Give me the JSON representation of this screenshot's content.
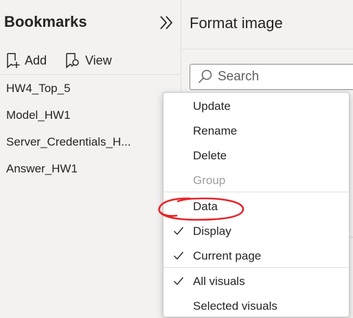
{
  "bookmarks": {
    "title": "Bookmarks",
    "toolbar": {
      "add_label": "Add",
      "view_label": "View"
    },
    "items": [
      {
        "label": "HW4_Top_5"
      },
      {
        "label": "Model_HW1"
      },
      {
        "label": "Server_Credentials_H..."
      },
      {
        "label": "Answer_HW1"
      }
    ]
  },
  "format_pane": {
    "title": "Format image",
    "search": {
      "placeholder": "Search"
    }
  },
  "context_menu": {
    "items": [
      {
        "label": "Update",
        "checked": false,
        "disabled": false
      },
      {
        "label": "Rename",
        "checked": false,
        "disabled": false
      },
      {
        "label": "Delete",
        "checked": false,
        "disabled": false
      },
      {
        "label": "Group",
        "checked": false,
        "disabled": true
      },
      {
        "label": "Data",
        "checked": false,
        "disabled": false,
        "annotated": true
      },
      {
        "label": "Display",
        "checked": true,
        "disabled": false
      },
      {
        "label": "Current page",
        "checked": true,
        "disabled": false
      },
      {
        "label": "All visuals",
        "checked": true,
        "disabled": false
      },
      {
        "label": "Selected visuals",
        "checked": false,
        "disabled": false
      }
    ]
  },
  "colors": {
    "pane_background": "#f3f2f1",
    "menu_background": "#ffffff",
    "text": "#252423",
    "disabled_text": "#a19f9d",
    "annotation": "#e3262c"
  }
}
